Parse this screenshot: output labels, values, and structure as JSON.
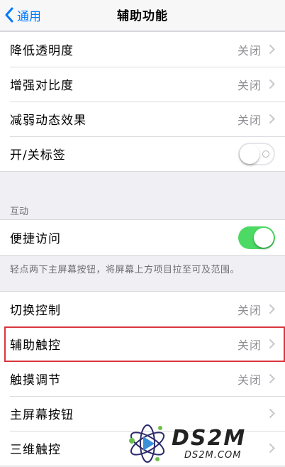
{
  "nav": {
    "back_label": "通用",
    "title": "辅助功能"
  },
  "group1": [
    {
      "label": "降低透明度",
      "value": "关闭"
    },
    {
      "label": "增强对比度",
      "value": "关闭"
    },
    {
      "label": "减弱动态效果",
      "value": "关闭"
    },
    {
      "label": "开/关标签",
      "toggle": "off"
    }
  ],
  "interaction": {
    "header": "互动",
    "row_label": "便捷访问",
    "toggle": "on",
    "footer": "轻点两下主屏幕按钮，将屏幕上方项目拉至可及范围。"
  },
  "group3": [
    {
      "label": "切换控制",
      "value": "关闭"
    },
    {
      "label": "辅助触控",
      "value": "关闭",
      "highlighted": true
    },
    {
      "label": "触摸调节",
      "value": "关闭"
    },
    {
      "label": "主屏幕按钮"
    },
    {
      "label": "三维触控"
    }
  ],
  "watermark": {
    "big": "DS2M",
    "small": "DS2M.COM"
  },
  "colors": {
    "accent": "#007aff",
    "toggle_on": "#4cd964",
    "highlight": "#d9363e"
  }
}
